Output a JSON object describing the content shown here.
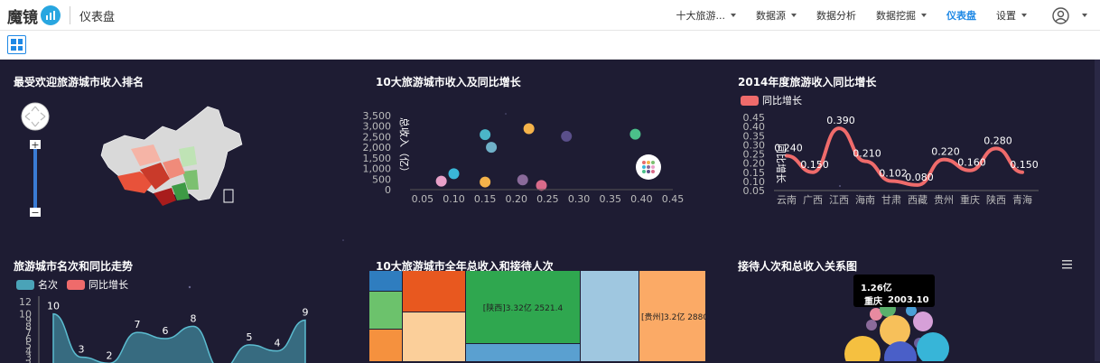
{
  "app": {
    "logo_text": "魔镜",
    "name": "仪表盘"
  },
  "nav": {
    "items": [
      {
        "label": "十大旅游...",
        "caret": true,
        "active": false
      },
      {
        "label": "数据源",
        "caret": true,
        "active": false
      },
      {
        "label": "数据分析",
        "caret": false,
        "active": false
      },
      {
        "label": "数据挖掘",
        "caret": true,
        "active": false
      },
      {
        "label": "仪表盘",
        "caret": false,
        "active": true
      },
      {
        "label": "设置",
        "caret": true,
        "active": false
      }
    ]
  },
  "panels": {
    "map_title": "最受欢迎旅游城市收入排名",
    "scatter_title": "10大旅游城市收入及同比增长",
    "growth_title": "2014年度旅游收入同比增长",
    "rank_title": "旅游城市名次和同比走势",
    "treemap_title": "10大旅游城市全年总收入和接待人次",
    "bubble_title": "接待人次和总收入关系图"
  },
  "colors": {
    "accent": "#1e88e5",
    "bg": "#1e1c33",
    "growth_line": "#ef6b6b",
    "rank_area": "#4aa3b8"
  },
  "chart_data": [
    {
      "type": "scatter",
      "title": "10大旅游城市收入及同比增长",
      "ylabel": "总收入（亿）",
      "x_ticks": [
        "0.05",
        "0.10",
        "0.15",
        "0.20",
        "0.25",
        "0.30",
        "0.35",
        "0.40",
        "0.45"
      ],
      "y_ticks": [
        "0",
        "500",
        "1,000",
        "1,500",
        "2,000",
        "2,500",
        "3,000",
        "3,500"
      ],
      "xlim": [
        0.03,
        0.45
      ],
      "ylim": [
        0,
        3500
      ],
      "points": [
        {
          "x": 0.08,
          "y": 400,
          "color": "#e8a0c8"
        },
        {
          "x": 0.1,
          "y": 750,
          "color": "#3ab7d8"
        },
        {
          "x": 0.15,
          "y": 360,
          "color": "#f5b34a"
        },
        {
          "x": 0.15,
          "y": 2600,
          "color": "#4bb6c8"
        },
        {
          "x": 0.16,
          "y": 2000,
          "color": "#6fb0c8"
        },
        {
          "x": 0.21,
          "y": 460,
          "color": "#8a6a9a"
        },
        {
          "x": 0.22,
          "y": 2880,
          "color": "#f5b34a"
        },
        {
          "x": 0.24,
          "y": 200,
          "color": "#d96b8a"
        },
        {
          "x": 0.28,
          "y": 2521,
          "color": "#5a4f8a"
        },
        {
          "x": 0.39,
          "y": 2620,
          "color": "#4bc08a"
        }
      ]
    },
    {
      "type": "line",
      "title": "2014年度旅游收入同比增长",
      "ylabel": "同比增长",
      "series": [
        {
          "name": "同比增长",
          "values": [
            0.24,
            0.15,
            0.39,
            0.21,
            0.102,
            0.08,
            0.22,
            0.16,
            0.28,
            0.15
          ]
        }
      ],
      "value_labels": [
        "0.240",
        "0.150",
        "0.390",
        "0.210",
        "0.102",
        "0.080",
        "0.220",
        "0.160",
        "0.280",
        "0.150"
      ],
      "categories": [
        "云南",
        "广西",
        "江西",
        "海南",
        "甘肃",
        "西藏",
        "贵州",
        "重庆",
        "陕西",
        "青海"
      ],
      "y_ticks": [
        "0.05",
        "0.10",
        "0.15",
        "0.20",
        "0.25",
        "0.30",
        "0.35",
        "0.40",
        "0.45"
      ],
      "ylim": [
        0.05,
        0.45
      ]
    },
    {
      "type": "area",
      "title": "旅游城市名次和同比走势",
      "series": [
        {
          "name": "名次",
          "values": [
            10,
            3,
            2,
            7,
            6,
            8,
            1,
            5,
            4,
            9
          ]
        },
        {
          "name": "同比增长",
          "values": []
        }
      ],
      "value_labels": [
        "10",
        "3",
        "2",
        "7",
        "6",
        "8",
        "5",
        "4",
        "9"
      ],
      "y_ticks": [
        "2",
        "3",
        "4",
        "5",
        "6",
        "7",
        "8",
        "9",
        "10",
        "12"
      ],
      "ylim": [
        0,
        12
      ]
    },
    {
      "type": "treemap",
      "title": "10大旅游城市全年总收入和接待人次",
      "labels": [
        "[陕西]3.32亿 2521.4",
        "[贵州]3.2亿 2880"
      ]
    },
    {
      "type": "bubble",
      "title": "接待人次和总收入关系图",
      "tooltip": {
        "value": "1.26亿",
        "city": "重庆",
        "amount": "2003.10"
      }
    }
  ]
}
